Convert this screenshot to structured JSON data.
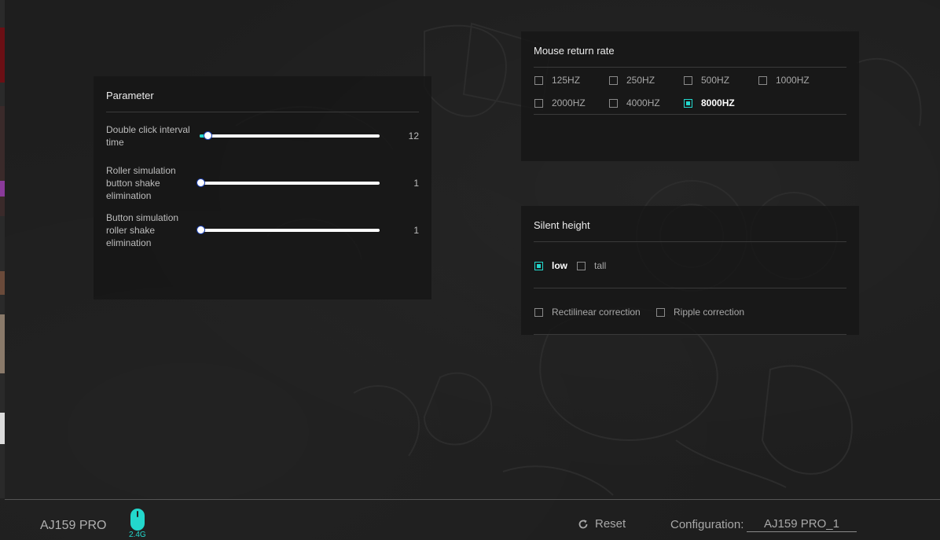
{
  "parameter_panel": {
    "title": "Parameter",
    "items": [
      {
        "label": "Double click interval time",
        "value": "12",
        "fraction": 0.07
      },
      {
        "label": "Roller simulation button shake elimination",
        "value": "1",
        "fraction": 0.0
      },
      {
        "label": "Button simulation roller shake elimination",
        "value": "1",
        "fraction": 0.0
      }
    ]
  },
  "return_rate_panel": {
    "title": "Mouse return rate",
    "options": [
      {
        "label": "125HZ",
        "checked": false
      },
      {
        "label": "250HZ",
        "checked": false
      },
      {
        "label": "500HZ",
        "checked": false
      },
      {
        "label": "1000HZ",
        "checked": false
      },
      {
        "label": "2000HZ",
        "checked": false
      },
      {
        "label": "4000HZ",
        "checked": false
      },
      {
        "label": "8000HZ",
        "checked": true
      }
    ]
  },
  "silent_height_panel": {
    "title": "Silent height",
    "options": [
      {
        "label": "low",
        "checked": true
      },
      {
        "label": "tall",
        "checked": false
      }
    ],
    "corrections": [
      {
        "label": "Rectilinear correction",
        "checked": false
      },
      {
        "label": "Ripple correction",
        "checked": false
      }
    ]
  },
  "bottom_bar": {
    "device_name": "AJ159 PRO",
    "connection": "2.4G",
    "reset_label": "Reset",
    "config_label": "Configuration:",
    "config_value": "AJ159 PRO_1"
  },
  "colors": {
    "accent": "#23d7cc",
    "background": "#1f1f1f",
    "panel": "#161616"
  },
  "icons": [
    "mouse-icon",
    "reset-icon",
    "checkbox-icon"
  ]
}
